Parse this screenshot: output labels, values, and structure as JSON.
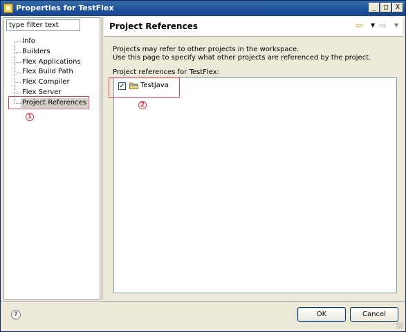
{
  "window": {
    "title": "Properties for TestFlex",
    "minimize": "_",
    "maximize": "□",
    "close": "X"
  },
  "filter": {
    "placeholder": "type filter text",
    "value": "type filter text"
  },
  "tree": {
    "items": [
      {
        "label": "Info"
      },
      {
        "label": "Builders"
      },
      {
        "label": "Flex Applications"
      },
      {
        "label": "Flex Build Path"
      },
      {
        "label": "Flex Compiler"
      },
      {
        "label": "Flex Server"
      },
      {
        "label": "Project References"
      }
    ],
    "selected": "Project References"
  },
  "page": {
    "title": "Project References",
    "description_line1": "Projects may refer to other projects in the workspace.",
    "description_line2": "Use this page to specify what other projects are referenced by the project.",
    "refs_label": "Project references for TestFlex:",
    "projects": [
      {
        "name": "TestJava",
        "checked": true
      }
    ]
  },
  "annotations": {
    "marker1": "1",
    "marker2": "2",
    "color": "#e03040"
  },
  "buttons": {
    "ok": "OK",
    "cancel": "Cancel",
    "help": "?"
  },
  "icons": {
    "back": "back-arrow-icon",
    "forward": "forward-arrow-icon",
    "project": "project-folder-icon",
    "app": "eclipse-app-icon"
  }
}
